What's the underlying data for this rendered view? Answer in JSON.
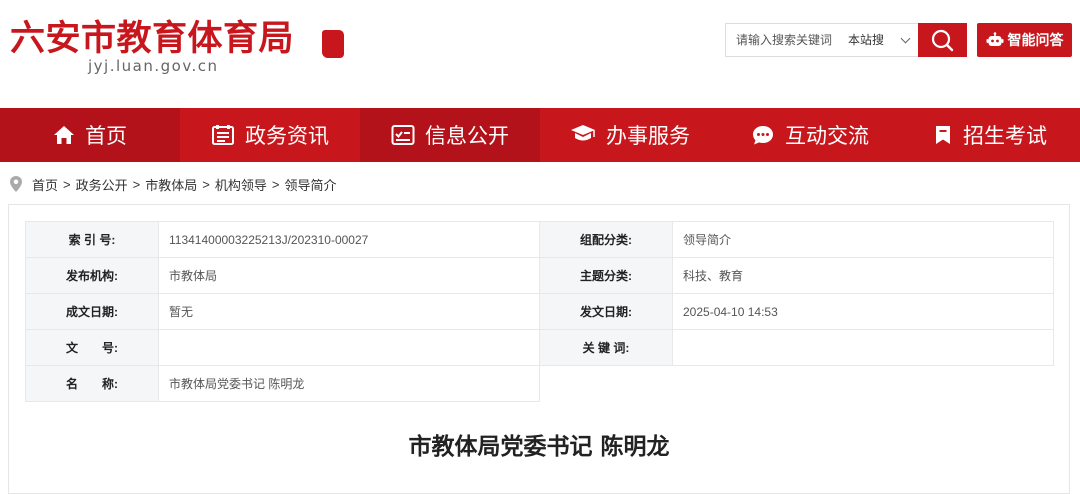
{
  "header": {
    "site_title": "六安市教育体育局",
    "domain": "jyj.luan.gov.cn",
    "search": {
      "placeholder": "请输入搜索关键词",
      "scope": "本站搜"
    },
    "ai_button_label": "智能问答"
  },
  "nav": {
    "items": [
      {
        "label": "首页",
        "icon": "home-icon"
      },
      {
        "label": "政务资讯",
        "icon": "news-icon"
      },
      {
        "label": "信息公开",
        "icon": "info-icon"
      },
      {
        "label": "办事服务",
        "icon": "service-icon"
      },
      {
        "label": "互动交流",
        "icon": "chat-icon"
      },
      {
        "label": "招生考试",
        "icon": "bookmark-icon"
      }
    ]
  },
  "breadcrumb": [
    "首页",
    "政务公开",
    "市教体局",
    "机构领导",
    "领导简介"
  ],
  "meta": {
    "index_no_label": "索 引 号:",
    "index_no": "11341400003225213J/202310-00027",
    "category_label": "组配分类:",
    "category": "领导简介",
    "publisher_label": "发布机构:",
    "publisher": "市教体局",
    "topic_label": "主题分类:",
    "topic": "科技、教育",
    "created_label": "成文日期:",
    "created": "暂无",
    "published_label": "发文日期:",
    "published": "2025-04-10 14:53",
    "doc_no_label": "文　　号:",
    "doc_no": "",
    "keywords_label": "关 键 词:",
    "keywords": "",
    "name_label": "名　　称:",
    "name": "市教体局党委书记 陈明龙"
  },
  "article_title": "市教体局党委书记 陈明龙",
  "colors": {
    "brand_red": "#c8161d",
    "nav_alt": "#b4121a",
    "label_bg": "#f5f6f8"
  }
}
